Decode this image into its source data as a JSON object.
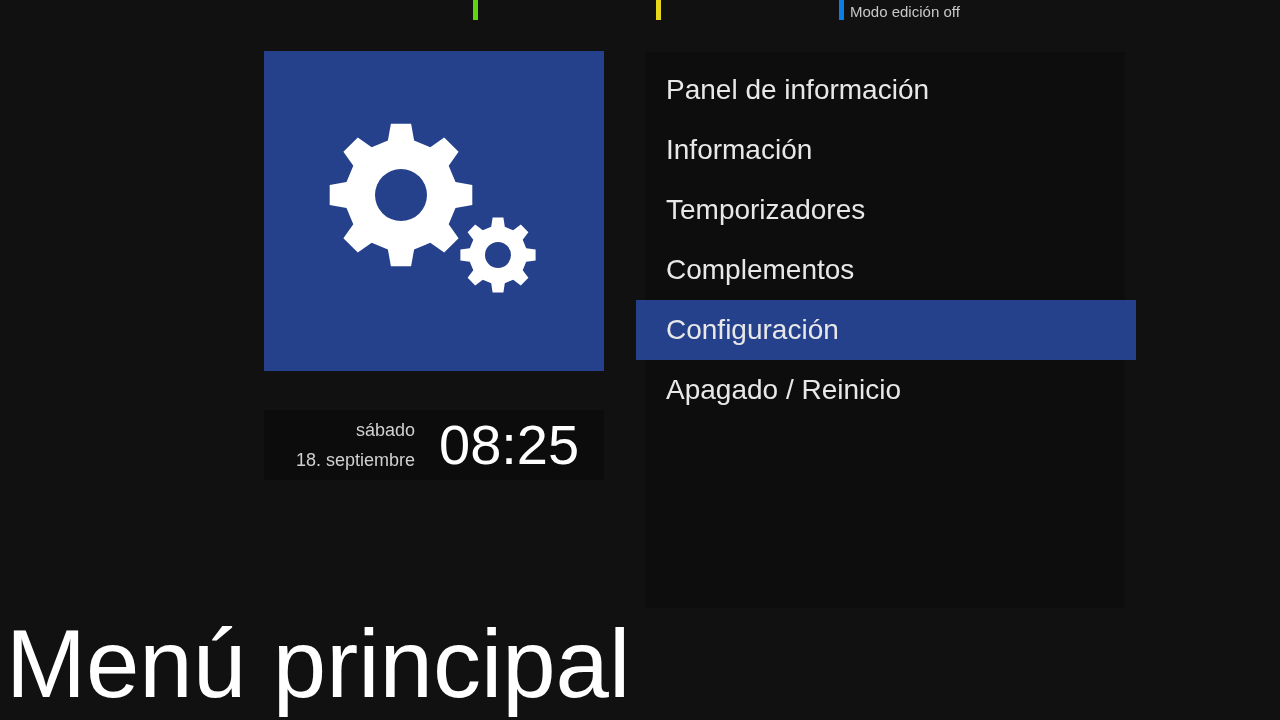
{
  "color_keys": [
    {
      "color": "#5fd60b"
    },
    {
      "color": "#e6d71a"
    },
    {
      "color": "#0a7ee6",
      "label": "Modo edición off"
    }
  ],
  "clock": {
    "weekday": "sábado",
    "date": "18. septiembre",
    "time": "08:25"
  },
  "menu": [
    {
      "label": "Panel de información",
      "selected": false
    },
    {
      "label": "Información",
      "selected": false
    },
    {
      "label": "Temporizadores",
      "selected": false
    },
    {
      "label": "Complementos",
      "selected": false
    },
    {
      "label": "Configuración",
      "selected": true
    },
    {
      "label": "Apagado / Reinicio",
      "selected": false
    }
  ],
  "title": "Menú principal"
}
